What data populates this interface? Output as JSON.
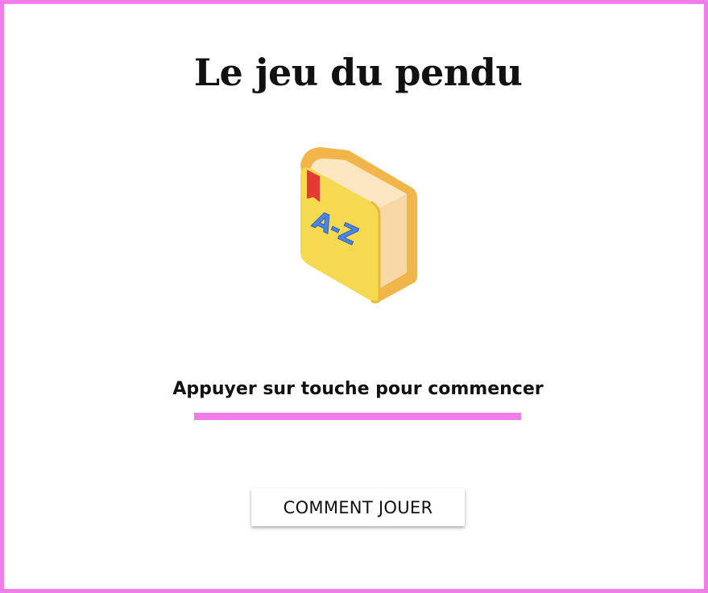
{
  "game": {
    "title": "Le jeu du pendu",
    "prompt": "Appuyer sur touche pour commencer",
    "how_to_play_label": "COMMENT JOUER"
  },
  "illustration": {
    "icon": "dictionary-book-icon",
    "cover_text": "A-Z"
  },
  "colors": {
    "accent": "#f17cec",
    "book_cover": "#f5d94e",
    "book_pages": "#f7d9a8",
    "bookmark": "#e53935",
    "letters": "#4a86e8"
  }
}
